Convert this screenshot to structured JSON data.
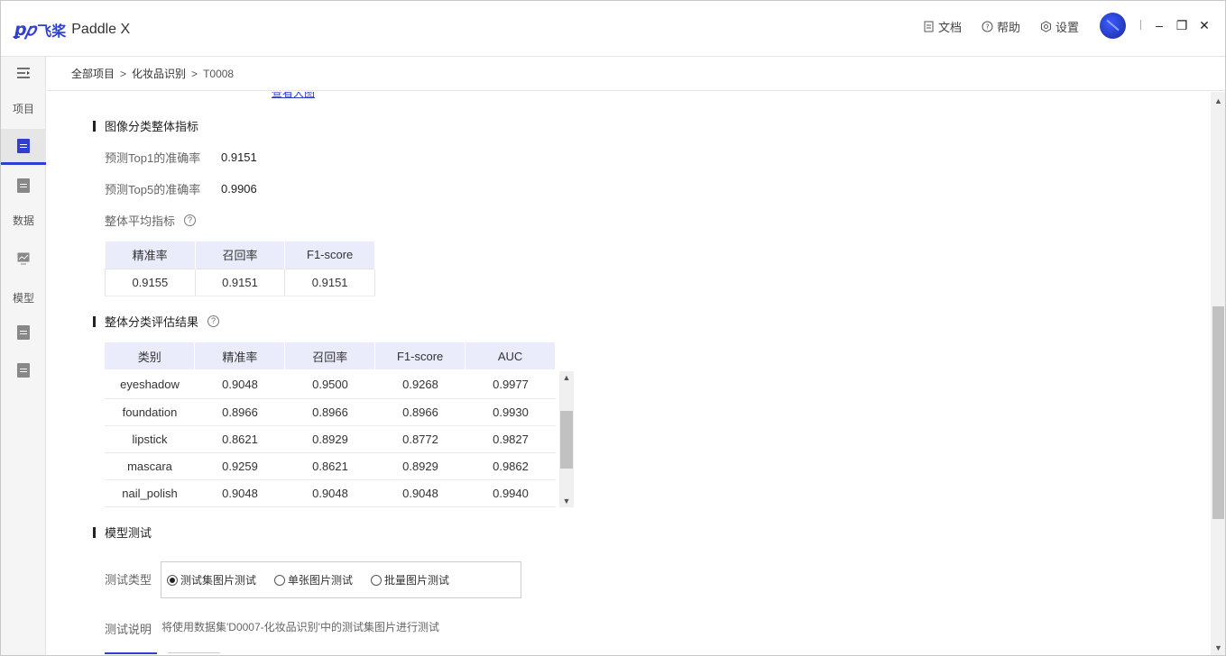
{
  "app": {
    "logo_mark": "ꝑ𝑝",
    "logo_cn": "飞桨",
    "logo_en": "Paddle X"
  },
  "header": {
    "links": [
      {
        "label": "文档",
        "icon": "doc-icon"
      },
      {
        "label": "帮助",
        "icon": "help-icon"
      },
      {
        "label": "设置",
        "icon": "gear-icon"
      }
    ],
    "window": {
      "minimize": "–",
      "restore": "❐",
      "close": "✕"
    }
  },
  "sidebar": {
    "items": [
      {
        "label": "项目"
      },
      {
        "label": "数据"
      },
      {
        "label": "模型"
      }
    ]
  },
  "breadcrumb": {
    "items": [
      "全部项目",
      "化妆品识别",
      "T0008"
    ],
    "sep": ">"
  },
  "partial": {
    "link": "查看大图"
  },
  "overall": {
    "title": "图像分类整体指标",
    "top1_label": "预测Top1的准确率",
    "top1_value": "0.9151",
    "top5_label": "预测Top5的准确率",
    "top5_value": "0.9906",
    "avg_label": "整体平均指标",
    "avg_table": {
      "headers": [
        "精准率",
        "召回率",
        "F1-score"
      ],
      "values": [
        "0.9155",
        "0.9151",
        "0.9151"
      ]
    }
  },
  "per_class": {
    "title": "整体分类评估结果",
    "headers": [
      "类别",
      "精准率",
      "召回率",
      "F1-score",
      "AUC"
    ],
    "rows": [
      [
        "eyeshadow",
        "0.9048",
        "0.9500",
        "0.9268",
        "0.9977"
      ],
      [
        "foundation",
        "0.8966",
        "0.8966",
        "0.8966",
        "0.9930"
      ],
      [
        "lipstick",
        "0.8621",
        "0.8929",
        "0.8772",
        "0.9827"
      ],
      [
        "mascara",
        "0.9259",
        "0.8621",
        "0.8929",
        "0.9862"
      ],
      [
        "nail_polish",
        "0.9048",
        "0.9048",
        "0.9048",
        "0.9940"
      ]
    ]
  },
  "test": {
    "title": "模型测试",
    "type_label": "测试类型",
    "options": [
      "测试集图片测试",
      "单张图片测试",
      "批量图片测试"
    ],
    "selected": 0,
    "desc_label": "测试说明",
    "desc": "将使用数据集'D0007-化妆品识别'中的测试集图片进行测试"
  },
  "colors": {
    "accent": "#2f3fd1",
    "table_header": "#eaecfb"
  }
}
